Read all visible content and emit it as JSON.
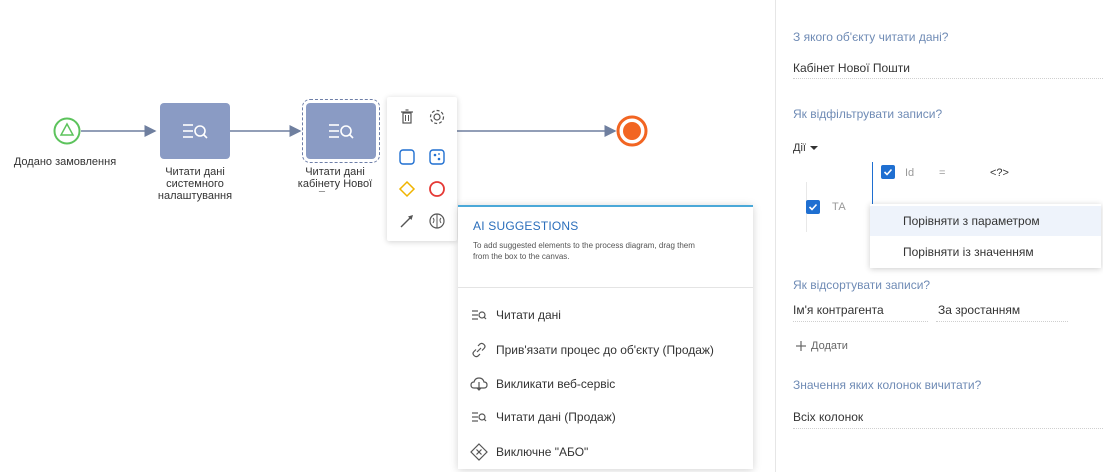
{
  "diagram": {
    "start_label": "Додано замовлення",
    "task1_label": "Читати дані системного налаштування",
    "task2_label": "Читати дані кабінету Нової Пошти"
  },
  "ai_panel": {
    "title": "AI SUGGESTIONS",
    "description": "To add suggested elements to the process diagram, drag them from the box to the canvas.",
    "items": [
      {
        "label": "Читати дані",
        "icon": "read-data-icon"
      },
      {
        "label": "Прив'язати процес до об'єкту (Продаж)",
        "icon": "link-icon"
      },
      {
        "label": "Викликати веб-сервіс",
        "icon": "web-service-icon"
      },
      {
        "label": "Читати дані (Продаж)",
        "icon": "read-data-icon"
      },
      {
        "label": "Виключне \"АБО\"",
        "icon": "exclusive-gateway-icon"
      }
    ]
  },
  "properties": {
    "object_question": "З якого об'єкту читати дані?",
    "object_value": "Кабінет Нової Пошти",
    "filter_question": "Як відфільтрувати записи?",
    "actions_label": "Дії",
    "filter_group": "ТА",
    "filter_column": "Id",
    "filter_operator": "=",
    "filter_value": "<?>",
    "dropdown_items": [
      "Порівняти з параметром",
      "Порівняти із значенням"
    ],
    "sort_question": "Як відсортувати записи?",
    "sort_column": "Ім'я контрагента",
    "sort_order": "За зростанням",
    "add_label": "Додати",
    "columns_question": "Значення яких колонок вичитати?",
    "columns_value": "Всіх колонок"
  },
  "colors": {
    "task": "#8a9bc4",
    "start": "#5cc35c",
    "end": "#f26522",
    "accent": "#1f6fd1",
    "question": "#6f8bb5"
  }
}
